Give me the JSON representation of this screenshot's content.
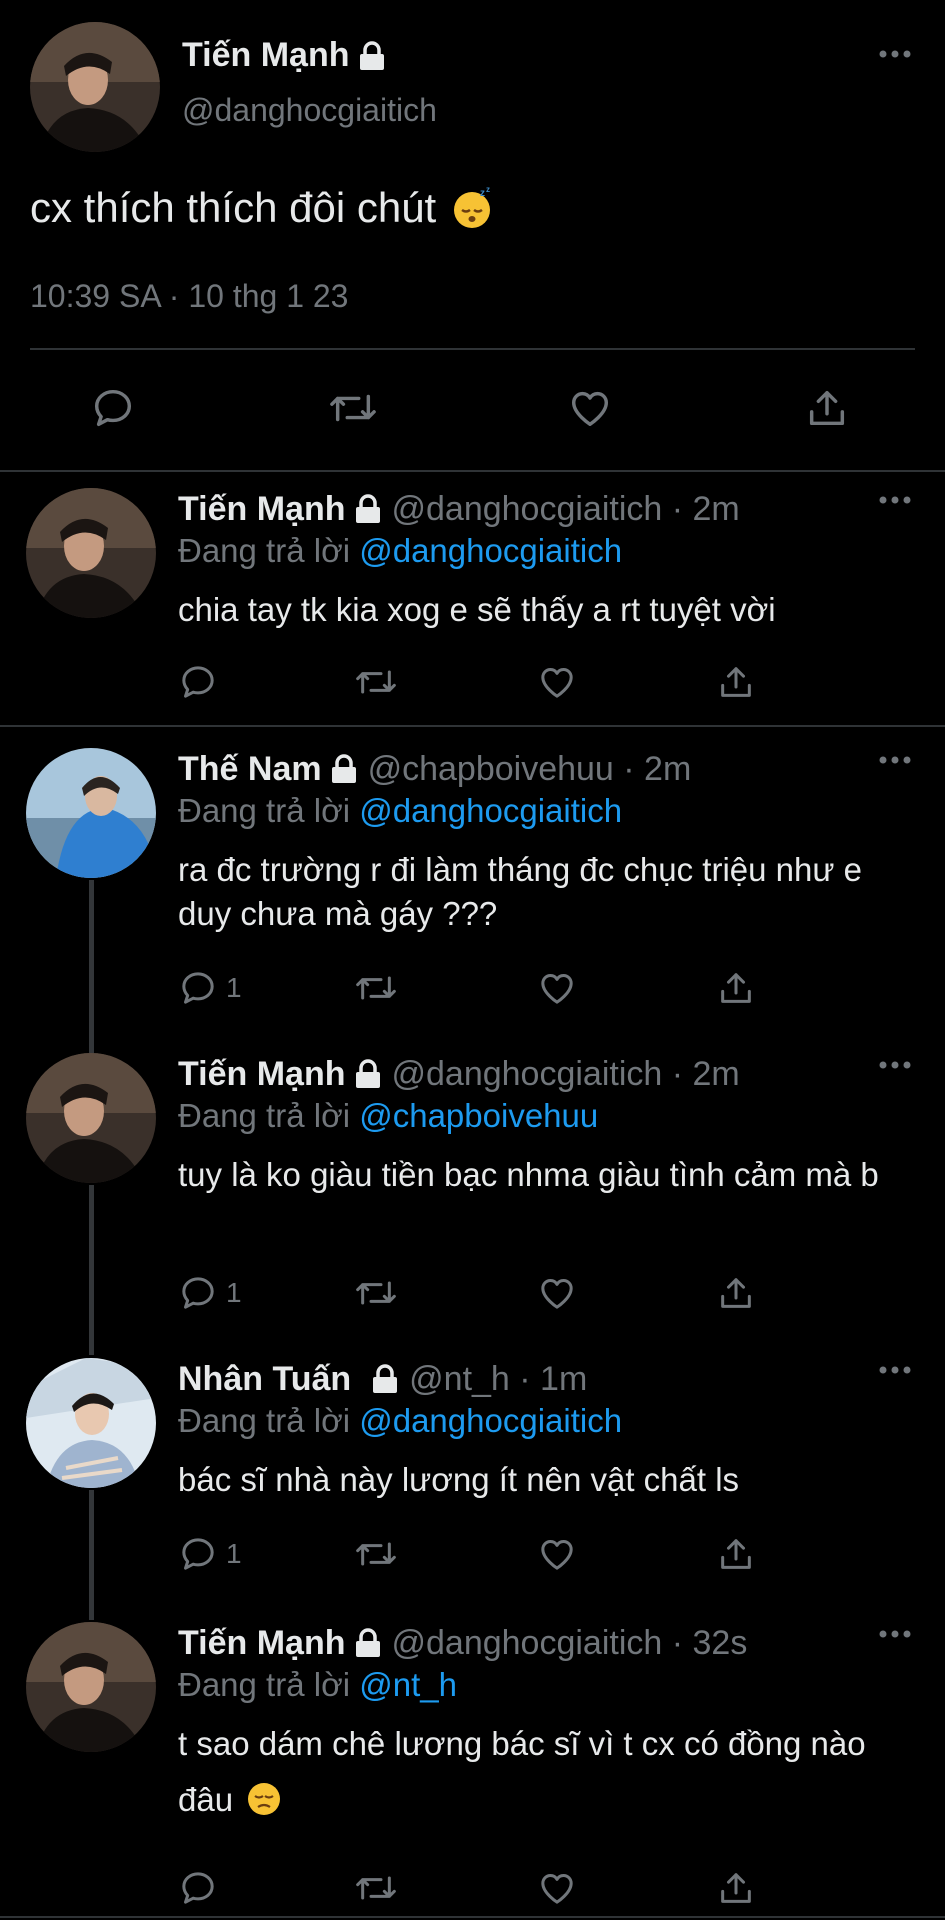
{
  "main_tweet": {
    "name": "Tiến Mạnh",
    "handle": "@danghocgiaitich",
    "text": "cx thích thích đôi chút",
    "emoji": "sleeping-face",
    "meta": "10:39 SA · 10 thg 1 23"
  },
  "replies": [
    {
      "name": "Tiến Mạnh",
      "handle": "@danghocgiaitich · 2m",
      "replying_label": "Đang trả lời",
      "replying_to": "@danghocgiaitich",
      "text": "chia tay tk kia xog e sẽ thấy a rt tuyệt vời",
      "reply_count": ""
    },
    {
      "name": "Thế Nam",
      "handle": "@chapboivehuu · 2m",
      "replying_label": "Đang trả lời",
      "replying_to": "@danghocgiaitich",
      "text": "ra đc trường r đi làm tháng đc chục triệu như e duy chưa mà gáy ???",
      "reply_count": "1"
    },
    {
      "name": "Tiến Mạnh",
      "handle": "@danghocgiaitich · 2m",
      "replying_label": "Đang trả lời",
      "replying_to": "@chapboivehuu",
      "text": "tuy là ko giàu tiền bạc nhma giàu tình cảm mà b",
      "reply_count": "1"
    },
    {
      "name": "Nhân Tuấn",
      "handle": "@nt_h · 1m",
      "replying_label": "Đang trả lời",
      "replying_to": "@danghocgiaitich",
      "text": "bác sĩ nhà này lương ít nên vật chất ls",
      "reply_count": "1"
    },
    {
      "name": "Tiến Mạnh",
      "handle": "@danghocgiaitich · 32s",
      "replying_label": "Đang trả lời",
      "replying_to": "@nt_h",
      "text": "t sao dám chê lương bác sĩ vì t cx có đồng nào đâu",
      "emoji": "pensive-face",
      "reply_count": ""
    }
  ],
  "colors": {
    "background": "#000000",
    "text": "#e7e9ea",
    "secondary": "#71767b",
    "link": "#1d9bf0",
    "divider": "#2f3336"
  }
}
